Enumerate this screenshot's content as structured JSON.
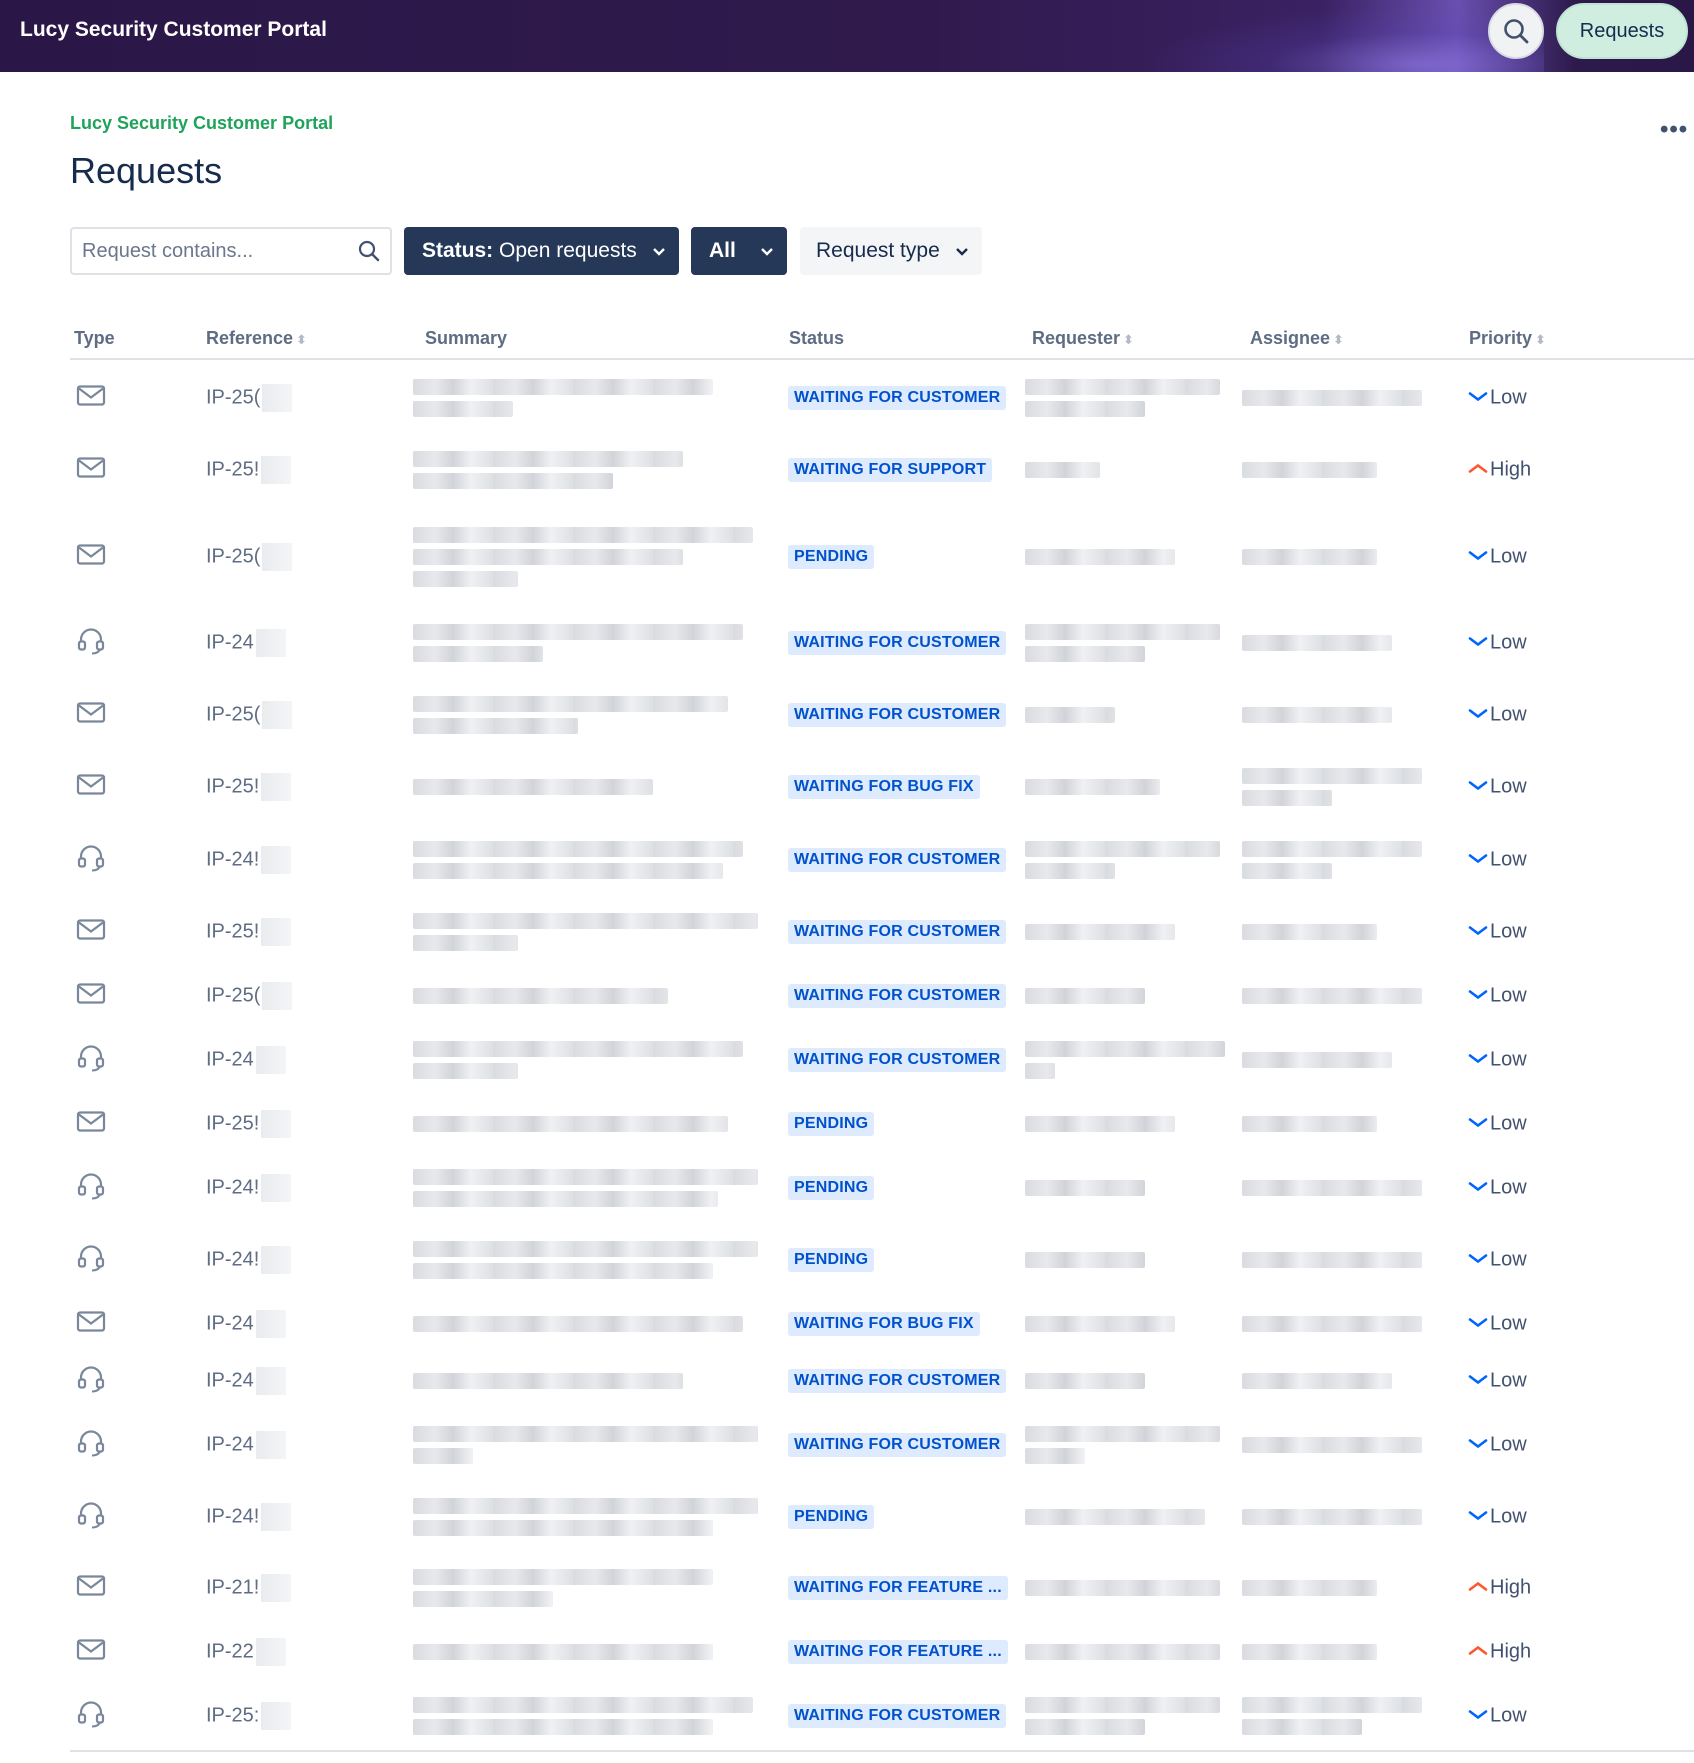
{
  "app": {
    "brand": "Lucy Security Customer Portal",
    "nav_requests": "Requests"
  },
  "page": {
    "breadcrumb": "Lucy Security Customer Portal",
    "title": "Requests"
  },
  "filters": {
    "search_placeholder": "Request contains...",
    "status_label": "Status:",
    "status_value": "Open requests",
    "scope": "All",
    "request_type": "Request type"
  },
  "table": {
    "headers": {
      "type": "Type",
      "reference": "Reference",
      "summary": "Summary",
      "status": "Status",
      "requester": "Requester",
      "assignee": "Assignee",
      "priority": "Priority"
    },
    "rows": [
      {
        "type": "mail-icon",
        "ref": "IP-25(",
        "status": "WAITING FOR CUSTOMER",
        "priority": "Low"
      },
      {
        "type": "mail-icon",
        "ref": "IP-25!",
        "status": "WAITING FOR SUPPORT",
        "priority": "High"
      },
      {
        "type": "mail-icon",
        "ref": "IP-25(",
        "status": "PENDING",
        "priority": "Low"
      },
      {
        "type": "headset-icon",
        "ref": "IP-24",
        "status": "WAITING FOR CUSTOMER",
        "priority": "Low"
      },
      {
        "type": "mail-icon",
        "ref": "IP-25(",
        "status": "WAITING FOR CUSTOMER",
        "priority": "Low"
      },
      {
        "type": "mail-icon",
        "ref": "IP-25!",
        "status": "WAITING FOR BUG FIX",
        "priority": "Low"
      },
      {
        "type": "headset-icon",
        "ref": "IP-24!",
        "status": "WAITING FOR CUSTOMER",
        "priority": "Low"
      },
      {
        "type": "mail-icon",
        "ref": "IP-25!",
        "status": "WAITING FOR CUSTOMER",
        "priority": "Low"
      },
      {
        "type": "mail-icon",
        "ref": "IP-25(",
        "status": "WAITING FOR CUSTOMER",
        "priority": "Low"
      },
      {
        "type": "headset-icon",
        "ref": "IP-24",
        "status": "WAITING FOR CUSTOMER",
        "priority": "Low"
      },
      {
        "type": "mail-icon",
        "ref": "IP-25!",
        "status": "PENDING",
        "priority": "Low"
      },
      {
        "type": "headset-icon",
        "ref": "IP-24!",
        "status": "PENDING",
        "priority": "Low"
      },
      {
        "type": "headset-icon",
        "ref": "IP-24!",
        "status": "PENDING",
        "priority": "Low"
      },
      {
        "type": "mail-icon",
        "ref": "IP-24",
        "status": "WAITING FOR BUG FIX",
        "priority": "Low"
      },
      {
        "type": "headset-icon",
        "ref": "IP-24",
        "status": "WAITING FOR CUSTOMER",
        "priority": "Low"
      },
      {
        "type": "headset-icon",
        "ref": "IP-24",
        "status": "WAITING FOR CUSTOMER",
        "priority": "Low"
      },
      {
        "type": "headset-icon",
        "ref": "IP-24!",
        "status": "PENDING",
        "priority": "Low"
      },
      {
        "type": "mail-icon",
        "ref": "IP-21!",
        "status": "WAITING FOR FEATURE ...",
        "priority": "High"
      },
      {
        "type": "mail-icon",
        "ref": "IP-22",
        "status": "WAITING FOR FEATURE ...",
        "priority": "High"
      },
      {
        "type": "headset-icon",
        "ref": "IP-25:",
        "status": "WAITING FOR CUSTOMER",
        "priority": "Low"
      }
    ]
  }
}
